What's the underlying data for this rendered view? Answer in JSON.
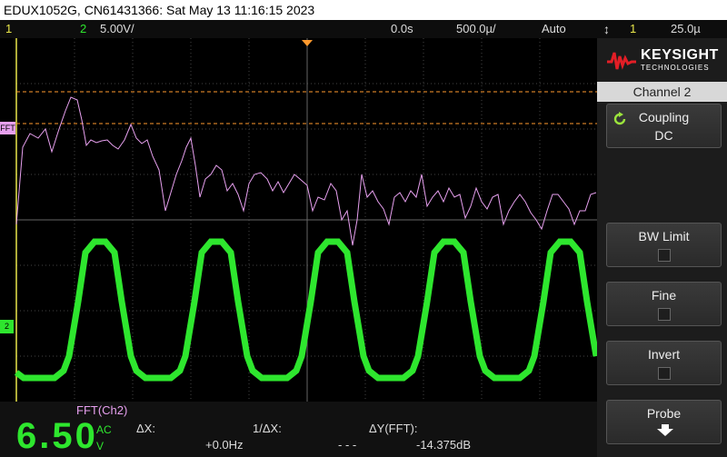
{
  "titlebar": {
    "text": "EDUX1052G, CN61431366: Sat May 13 11:16:15 2023"
  },
  "status": {
    "ch1_number": "1",
    "ch2_number": "2",
    "ch2_scale": "5.00V/",
    "time_delay": "0.0s",
    "time_scale": "500.0µ/",
    "trigger_mode": "Auto",
    "trigger_source": "1",
    "trigger_level": "25.0µ",
    "trigger_icon": "trigger-edge-icon"
  },
  "screen": {
    "fft_marker_label": "FFT",
    "ch2_marker_label": "2",
    "colors": {
      "ch1": "#e9e64a",
      "ch2": "#2ee62e",
      "fft": "#e7a0ef",
      "cursor": "#ff9a2e",
      "grid": "#555555"
    }
  },
  "panel": {
    "brand": "KEYSIGHT",
    "brand_sub": "TECHNOLOGIES",
    "menu_title": "Channel 2",
    "coupling_label": "Coupling",
    "coupling_value": "DC",
    "bw_limit_label": "BW Limit",
    "fine_label": "Fine",
    "invert_label": "Invert",
    "probe_label": "Probe"
  },
  "bottom": {
    "fft_label": "FFT(Ch2)",
    "big_value": "6.50",
    "big_unit_top": "AC",
    "big_unit_bottom": "V",
    "dx_label": "ΔX:",
    "dx_value": "+0.0Hz",
    "inv_dx_label": "1/ΔX:",
    "inv_dx_value": "- - -",
    "dy_label": "ΔY(FFT):",
    "dy_value": "-14.375dB"
  }
}
